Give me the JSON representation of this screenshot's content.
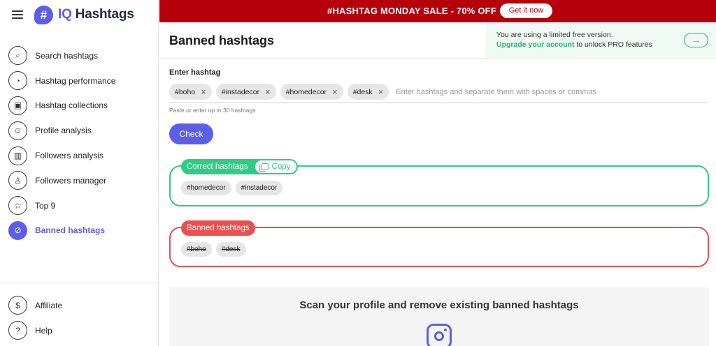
{
  "brand": {
    "prefix": "IQ",
    "name": "Hashtags",
    "logo_symbol": "#"
  },
  "sidebar": {
    "items": [
      {
        "label": "Search hashtags",
        "icon": "search-icon",
        "glyph": "⌕",
        "active": false
      },
      {
        "label": "Hashtag performance",
        "icon": "gauge-icon",
        "glyph": "◔",
        "active": false
      },
      {
        "label": "Hashtag collections",
        "icon": "folder-plus-icon",
        "glyph": "▣",
        "active": false
      },
      {
        "label": "Profile analysis",
        "icon": "face-icon",
        "glyph": "☺",
        "active": false
      },
      {
        "label": "Followers analysis",
        "icon": "bar-chart-icon",
        "glyph": "▥",
        "active": false
      },
      {
        "label": "Followers manager",
        "icon": "person-card-icon",
        "glyph": "♙",
        "active": false
      },
      {
        "label": "Top 9",
        "icon": "star-icon",
        "glyph": "☆",
        "active": false
      },
      {
        "label": "Banned hashtags",
        "icon": "ban-icon",
        "glyph": "⊘",
        "active": true
      }
    ],
    "bottom_items": [
      {
        "label": "Affiliate",
        "icon": "dollar-icon",
        "glyph": "$"
      },
      {
        "label": "Help",
        "icon": "question-icon",
        "glyph": "?"
      }
    ]
  },
  "banner": {
    "text": "#HASHTAG MONDAY SALE - 70% OFF",
    "button_label": "Get it now",
    "color": "#b5000c"
  },
  "header": {
    "title": "Banned hashtags",
    "notice_line1": "You are using a limited free version.",
    "notice_link": "Upgrade your account",
    "notice_rest": "to unlock PRO features",
    "arrow_glyph": "→"
  },
  "input": {
    "label": "Enter hashtag",
    "chips": [
      "#boho",
      "#instadecor",
      "#homedecor",
      "#desk"
    ],
    "placeholder": "Enter hashtags and separate them with spaces or commas",
    "hint": "Paste or enter up to 30 hashtags",
    "check_label": "Check"
  },
  "results": {
    "correct": {
      "label": "Correct hashtags",
      "copy_label": "Copy",
      "tags": [
        "#homedecor",
        "#instadecor"
      ],
      "color": "#2ecc84"
    },
    "banned": {
      "label": "Banned hashtags",
      "tags": [
        "#boho",
        "#desk"
      ],
      "color": "#eb4f4f"
    }
  },
  "scan": {
    "title": "Scan your profile and remove existing banned hashtags",
    "icon": "instagram-icon"
  },
  "accent": "#5b5fe8"
}
